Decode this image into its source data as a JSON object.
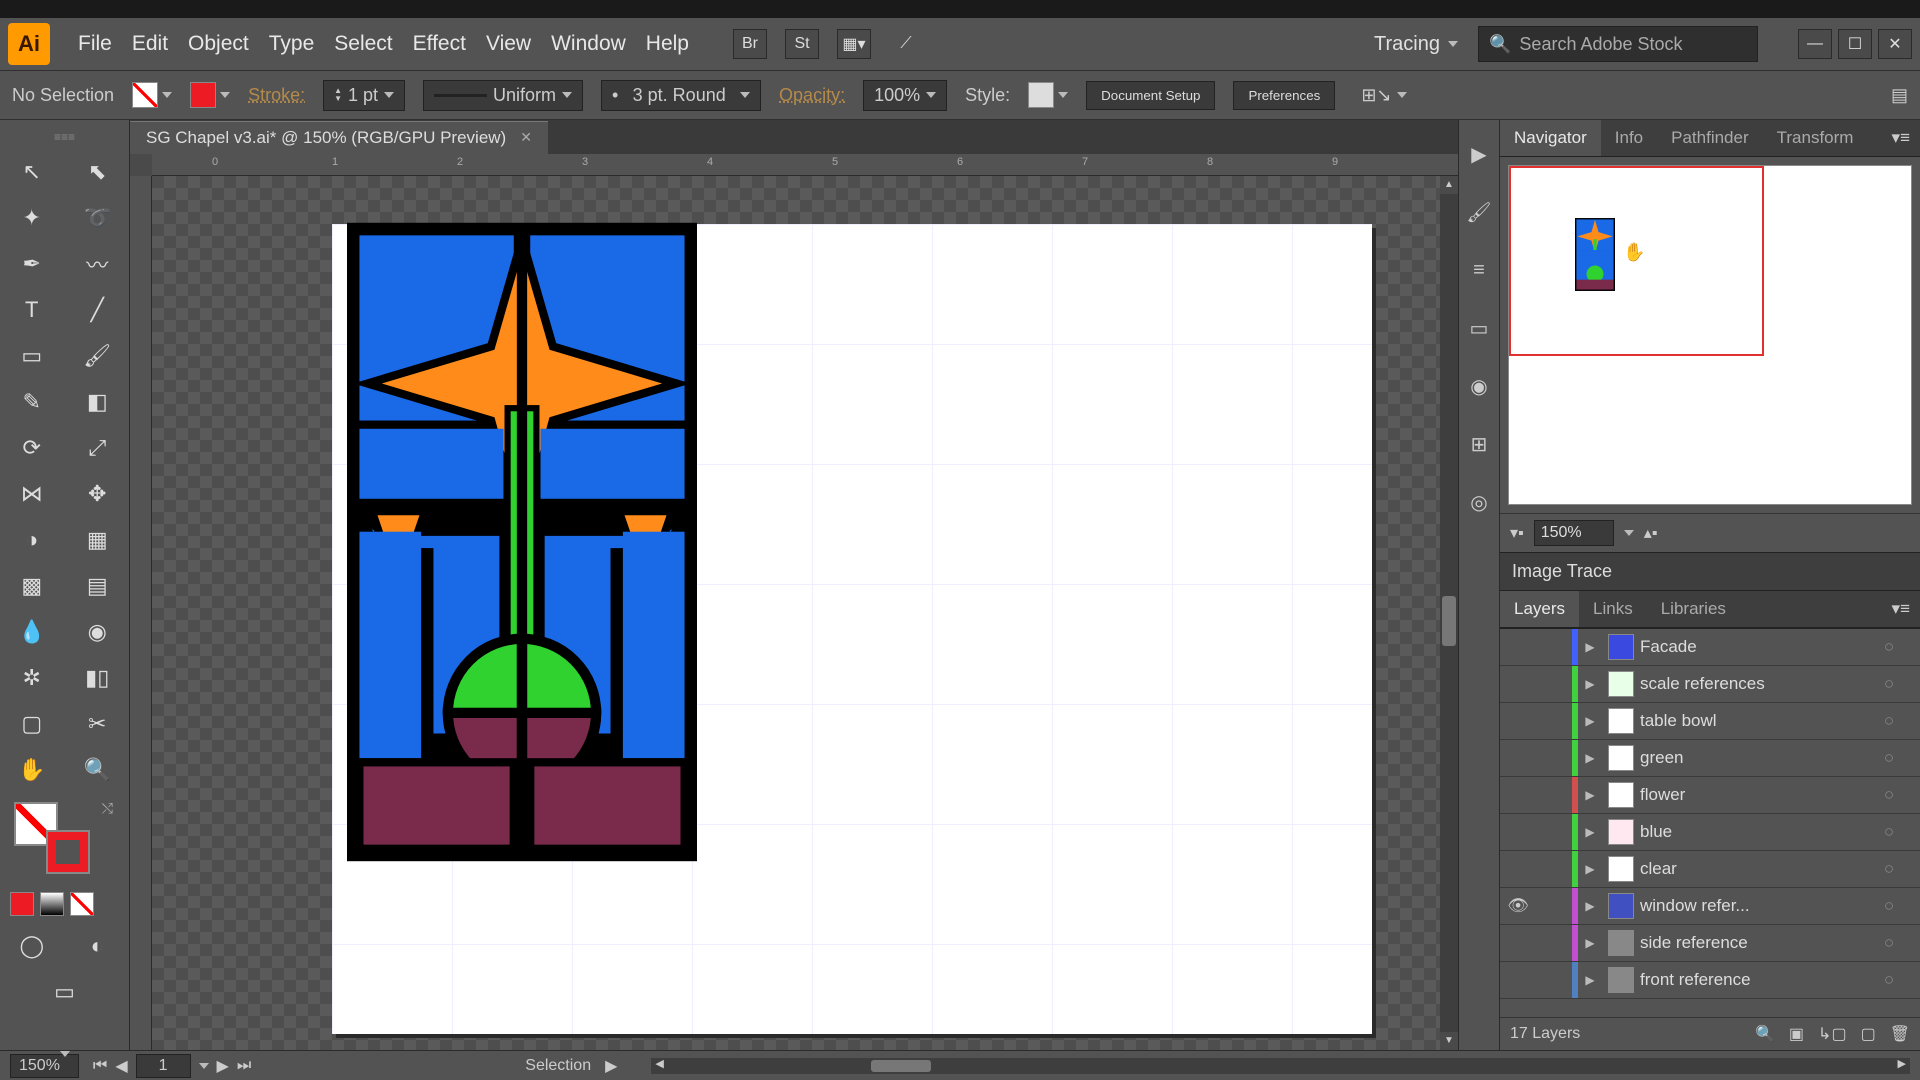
{
  "app": {
    "name": "Ai"
  },
  "menus": [
    "File",
    "Edit",
    "Object",
    "Type",
    "Select",
    "Effect",
    "View",
    "Window",
    "Help"
  ],
  "workspace": {
    "label": "Tracing"
  },
  "stock": {
    "placeholder": "Search Adobe Stock"
  },
  "control": {
    "selection": "No Selection",
    "stroke_label": "Stroke:",
    "stroke_weight": "1 pt",
    "stroke_profile": "Uniform",
    "stroke_cap": "3 pt. Round",
    "opacity_label": "Opacity:",
    "opacity_value": "100%",
    "style_label": "Style:",
    "doc_setup": "Document Setup",
    "preferences": "Preferences"
  },
  "document": {
    "tab_title": "SG Chapel v3.ai* @ 150% (RGB/GPU Preview)",
    "zoom": "150%",
    "artboard_page": "1",
    "tool_status": "Selection"
  },
  "panels": {
    "nav_tabs": [
      "Navigator",
      "Info",
      "Pathfinder",
      "Transform"
    ],
    "nav_active": 0,
    "nav_zoom": "150%",
    "image_trace": "Image Trace",
    "layer_tabs": [
      "Layers",
      "Links",
      "Libraries"
    ],
    "layer_active": 0,
    "layers": [
      {
        "name": "Facade",
        "color": "#4060ff",
        "thumb": "#3a4ae0",
        "visible": false
      },
      {
        "name": "scale references",
        "color": "#40d040",
        "thumb": "#e8ffe8",
        "visible": false
      },
      {
        "name": "table bowl",
        "color": "#40d040",
        "thumb": "#ffffff",
        "visible": false
      },
      {
        "name": "green",
        "color": "#40d040",
        "thumb": "#ffffff",
        "visible": false
      },
      {
        "name": "flower",
        "color": "#d05050",
        "thumb": "#ffffff",
        "visible": false
      },
      {
        "name": "blue",
        "color": "#40d040",
        "thumb": "#ffe8f0",
        "visible": false
      },
      {
        "name": "clear",
        "color": "#40d040",
        "thumb": "#ffffff",
        "visible": false
      },
      {
        "name": "window refer...",
        "color": "#c050d0",
        "thumb": "#4050c0",
        "visible": true
      },
      {
        "name": "side reference",
        "color": "#c050d0",
        "thumb": "#888888",
        "visible": false
      },
      {
        "name": "front reference",
        "color": "#5080c0",
        "thumb": "#888888",
        "visible": false
      }
    ],
    "layer_count": "17 Layers"
  },
  "colors": {
    "fill": "none",
    "stroke": "#ed1c24"
  },
  "chart_data": null
}
